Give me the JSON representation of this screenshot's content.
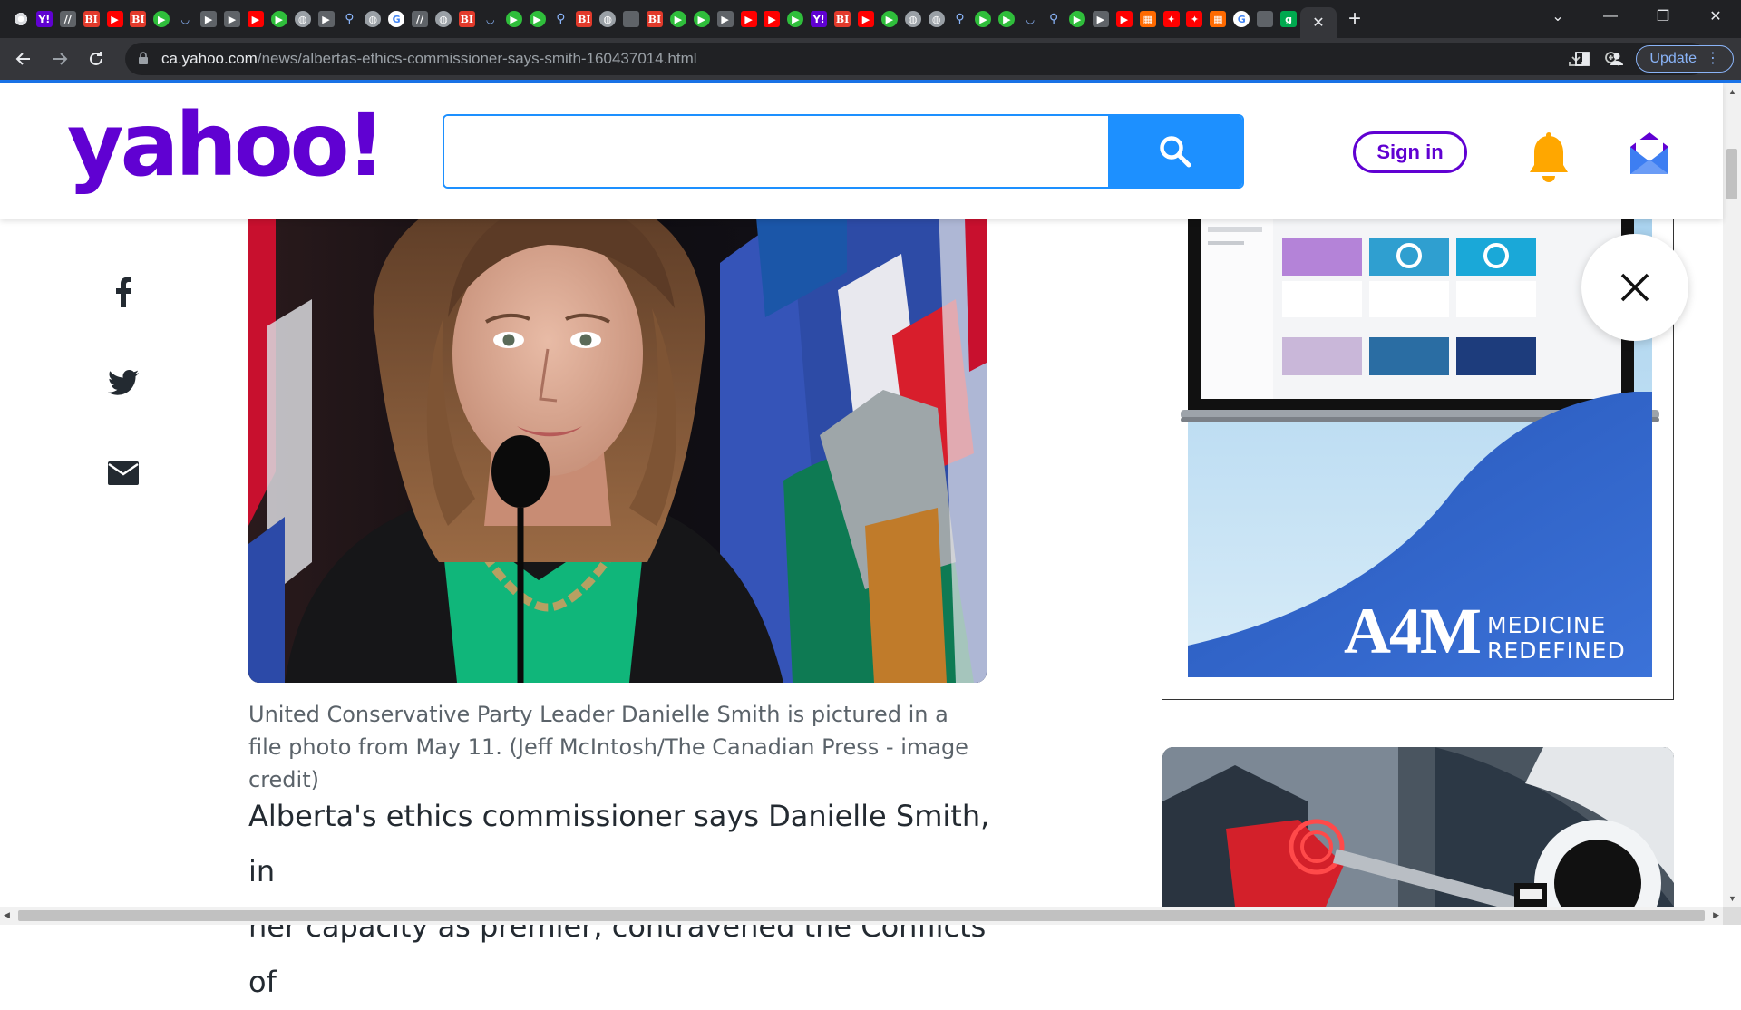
{
  "browser": {
    "tab_favicons": [
      "chrome",
      "yahoo",
      "slash",
      "bi",
      "yt",
      "bi",
      "play",
      "shield",
      "flag",
      "flag",
      "yt",
      "play",
      "globe",
      "flag",
      "search",
      "globe",
      "g",
      "slash",
      "globe",
      "bi",
      "shield",
      "play",
      "play",
      "search",
      "bi",
      "globe",
      "dark",
      "bi",
      "play",
      "play",
      "flag",
      "yt",
      "yt",
      "play",
      "yahoo",
      "bi",
      "yt",
      "play",
      "globe",
      "globe",
      "search",
      "play",
      "play",
      "shield",
      "search",
      "play",
      "flag",
      "yt",
      "orange",
      "red",
      "red",
      "orange",
      "g",
      "dark",
      "gg"
    ],
    "active_tab_close": "✕",
    "new_tab": "+",
    "url_host": "ca.yahoo.com",
    "url_path": "/news/albertas-ethics-commissioner-says-smith-160437014.html",
    "update_label": "Update",
    "window_controls": [
      "⌄",
      "—",
      "❐",
      "✕"
    ]
  },
  "header": {
    "logo": "yahoo!",
    "search_placeholder": "",
    "signin_label": "Sign in"
  },
  "share": [
    "facebook-icon",
    "twitter-icon",
    "mail-icon"
  ],
  "article": {
    "caption": "United Conservative Party Leader Danielle Smith is pictured in a file photo from May 11. (Jeff McIntosh/The Canadian Press - image credit)",
    "body_line1": "Alberta's ethics commissioner says Danielle Smith, in",
    "body_line2": "her capacity as premier, contravened the Conflicts of"
  },
  "ad": {
    "brand": "A4M",
    "tagline_1": "MEDICINE",
    "tagline_2": "REDEFINED"
  },
  "colors": {
    "yahoo_purple": "#6001d2",
    "search_blue": "#1d90ff",
    "bell_yellow": "#ffa700",
    "ad_blue": "#2f62c8"
  }
}
